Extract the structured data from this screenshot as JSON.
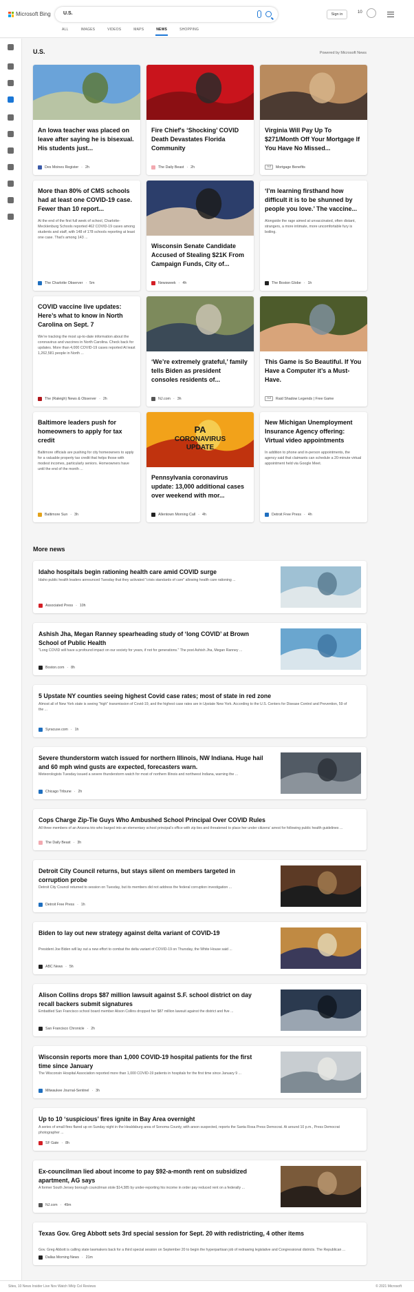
{
  "header": {
    "brand": "Microsoft Bing",
    "query": "U.S.",
    "sign_in": "Sign in",
    "rewards_count": "10"
  },
  "tabs": [
    {
      "label": "ALL",
      "active": false
    },
    {
      "label": "IMAGES",
      "active": false
    },
    {
      "label": "VIDEOS",
      "active": false
    },
    {
      "label": "MAPS",
      "active": false
    },
    {
      "label": "NEWS",
      "active": true
    },
    {
      "label": "SHOPPING",
      "active": false
    }
  ],
  "rail": [
    "expand-icon",
    "home-icon",
    "trending-icon",
    "flag-icon",
    "location-icon",
    "globe-icon",
    "finance-icon",
    "science-icon",
    "entertainment-icon",
    "business-icon",
    "car-icon"
  ],
  "section": {
    "title": "U.S.",
    "powered": "Powered by Microsoft News"
  },
  "cards": [
    {
      "headline": "An Iowa teacher was placed on leave after saying he is bisexual. His students just...",
      "summary": "",
      "source": "Des Moines Register",
      "time": "2h",
      "ad": false,
      "color": "#3b5aa8",
      "thumb": [
        "#6aa3d9",
        "#b8c4a4",
        "#5d7a3c"
      ]
    },
    {
      "headline": "Fire Chief's ‘Shocking’ COVID Death Devastates Florida Community",
      "summary": "",
      "source": "The Daily Beast",
      "time": "2h",
      "ad": false,
      "color": "#f2a9b0",
      "thumb": [
        "#c9141c",
        "#8b0f13",
        "#2a2a2a"
      ]
    },
    {
      "headline": "Virginia Will Pay Up To $271/Month Off Your Mortgage If You Have No Missed...",
      "summary": "",
      "source": "Mortgage Benefits",
      "time": "",
      "ad": true,
      "color": "#ffffff",
      "thumb": [
        "#b98b5e",
        "#4c3b32",
        "#d6b48a"
      ]
    },
    {
      "headline": "More than 80% of CMS schools had at least one COVID-19 case. Fewer than 10 report...",
      "summary": "At the end of the first full week of school, Charlotte-Mecklenburg Schools reported 462 COVID-19 cases among students and staff, with 148 of 178 schools reporting at least one case. That’s among 143 ...",
      "source": "The Charlotte Observer",
      "time": "5m",
      "ad": false,
      "color": "#1f6fbf",
      "thumb": null
    },
    {
      "headline": "Wisconsin Senate Candidate Accused of Stealing $21K From Campaign Funds, City of...",
      "summary": "",
      "source": "Newsweek",
      "time": "4h",
      "ad": false,
      "color": "#d41f26",
      "thumb": [
        "#2c3e6b",
        "#c9b7a4",
        "#1c1c1c"
      ]
    },
    {
      "headline": "‘I’m learning firsthand how difficult it is to be shunned by people you love.’ The vaccine...",
      "summary": "Alongside the rage aimed at unvaccinated, often distant, strangers, a more intimate, more uncomfortable fury is boiling.",
      "source": "The Boston Globe",
      "time": "1h",
      "ad": false,
      "color": "#222222",
      "thumb": null
    },
    {
      "headline": "COVID vaccine live updates: Here’s what to know in North Carolina on Sept. 7",
      "summary": "We’re tracking the most up-to-date information about the coronavirus and vaccines in North Carolina. Check back for updates. More than 4,000 COVID-19 cases reported At least 1,262,581 people in North ...",
      "source": "The (Raleigh) News & Observer",
      "time": "2h",
      "ad": false,
      "color": "#b0161b",
      "thumb": null
    },
    {
      "headline": "‘We’re extremely grateful,’ family tells Biden as president consoles residents of...",
      "summary": "",
      "source": "NJ.com",
      "time": "3h",
      "ad": false,
      "color": "#555555",
      "thumb": [
        "#7d8a5c",
        "#3b4a57",
        "#c8c2b0"
      ]
    },
    {
      "headline": "This Game is So Beautiful. If You Have a Computer it’s a Must-Have.",
      "summary": "",
      "source": "Raid Shadow Legends | Free Game",
      "time": "",
      "ad": true,
      "color": "#ffffff",
      "thumb": [
        "#4d5b2b",
        "#d8a47a",
        "#7e8f9b"
      ]
    },
    {
      "headline": "Baltimore leaders push for homeowners to apply for tax credit",
      "summary": "Baltimore officials are pushing for city homeowners to apply for a valuable property tax credit that helps those with modest incomes, particularly seniors. Homeowners have until the end of the month ...",
      "source": "Baltimore Sun",
      "time": "3h",
      "ad": false,
      "color": "#e3a21a",
      "thumb": null
    },
    {
      "headline": "Pennsylvania coronavirus update: 13,000 additional cases over weekend with mor...",
      "summary": "",
      "source": "Allentown Morning Call",
      "time": "4h",
      "ad": false,
      "color": "#222222",
      "thumb": [
        "#f2a21a",
        "#c0330e",
        "#f6d35a"
      ],
      "overlay": [
        "PA",
        "CORONAVIRUS",
        "UPDATE"
      ]
    },
    {
      "headline": "New Michigan Unemployment Insurance Agency offering: Virtual video appointments",
      "summary": "In addition to phone and in-person appointments, the agency said that claimants can schedule a 20-minute virtual appointment held via Google Meet.",
      "source": "Detroit Free Press",
      "time": "4h",
      "ad": false,
      "color": "#1f6fbf",
      "thumb": null
    }
  ],
  "more_news": {
    "title": "More news",
    "items": [
      {
        "headline": "Idaho hospitals begin rationing health care amid COVID surge",
        "summary": "Idaho public health leaders announced Tuesday that they activated \"crisis standards of care\" allowing health care rationing ...",
        "source": "Associated Press",
        "time": "10h",
        "color": "#d41f26",
        "thumb": [
          "#9fc1d4",
          "#dfe7ea",
          "#5a7d92"
        ]
      },
      {
        "headline": "Ashish Jha, Megan Ranney spearheading study of ‘long COVID’ at Brown School of Public Health",
        "summary": "\"Long COVID will have a profound impact on our society for years, if not for generations.\" The post Ashish Jha, Megan Ranney ...",
        "source": "Boston.com",
        "time": "8h",
        "color": "#222222",
        "thumb": [
          "#6aa6cf",
          "#d9e5ec",
          "#3f77a3"
        ]
      },
      {
        "headline": "5 Upstate NY counties seeing highest Covid case rates; most of state in red zone",
        "summary": "Almost all of New York state is seeing \"high\" transmission of Covid-19, and the highest case rates are in Upstate New York. According to the U.S. Centers for Disease Control and Prevention, 59 of the ...",
        "source": "Syracuse.com",
        "time": "1h",
        "color": "#1f6fbf",
        "thumb": null
      },
      {
        "headline": "Severe thunderstorm watch issued for northern Illinois, NW Indiana. Huge hail and 60 mph wind gusts are expected, forecasters warn.",
        "summary": "Meteorologists Tuesday issued a severe thunderstorm watch for most of northern Illinois and northwest Indiana, warning the ...",
        "source": "Chicago Tribune",
        "time": "2h",
        "color": "#1f6fbf",
        "thumb": [
          "#525b65",
          "#8b939b",
          "#2d333a"
        ]
      },
      {
        "headline": "Cops Charge Zip-Tie Guys Who Ambushed School Principal Over COVID Rules",
        "summary": "All three members of an Arizona trio who barged into an elementary school principal’s office with zip ties and threatened to place her under citizens’ arrest for following public health guidelines ...",
        "source": "The Daily Beast",
        "time": "3h",
        "color": "#f2a9b0",
        "thumb": null
      },
      {
        "headline": "Detroit City Council returns, but stays silent on members targeted in corruption probe",
        "summary": "Detroit City Council returned to session on Tuesday, but its members did not address the federal corruption investigation ...",
        "source": "Detroit Free Press",
        "time": "1h",
        "color": "#1f6fbf",
        "thumb": [
          "#5c3a25",
          "#1d1d1d",
          "#a07a4f"
        ]
      },
      {
        "headline": "Biden to lay out new strategy against delta variant of COVID-19",
        "summary": "President Joe Biden will lay out a new effort to combat the delta variant of COVID-19 on Thursday, the White House said ...",
        "source": "ABC News",
        "time": "5h",
        "color": "#222222",
        "thumb": [
          "#c08a43",
          "#3b3a5a",
          "#e2d4b0"
        ]
      },
      {
        "headline": "Alison Collins drops $87 million lawsuit against S.F. school district on day recall backers submit signatures",
        "summary": "Embattled San Francisco school board member Alison Collins dropped her $87 million lawsuit against the district and five ...",
        "source": "San Francisco Chronicle",
        "time": "2h",
        "color": "#222222",
        "thumb": [
          "#2b3a4f",
          "#9aa5b1",
          "#101820"
        ]
      },
      {
        "headline": "Wisconsin reports more than 1,000 COVID-19 hospital patients for the first time since January",
        "summary": "The Wisconsin Hospital Association reported more than 1,000 COVID-19 patients in hospitals for the first time since January 9 ...",
        "source": "Milwaukee Journal-Sentinel",
        "time": "3h",
        "color": "#1f6fbf",
        "thumb": [
          "#c8cdd1",
          "#7f8b94",
          "#e8e8e4"
        ]
      },
      {
        "headline": "Up to 10 ‘suspicious’ fires ignite in Bay Area overnight",
        "summary": "A series of small fires flared up on Sunday night in the Healdsburg area of Sonoma County, with arson suspected, reports the Santa Rosa Press Democrat. At around 10 p.m., Press Democrat photographer ...",
        "source": "SF Gate",
        "time": "8h",
        "color": "#d41f26",
        "thumb": null
      },
      {
        "headline": "Ex-councilman lied about income to pay $92-a-month rent on subsidized apartment, AG says",
        "summary": "A former South Jersey borough councilman stole $14,385 by under-reporting his income in order pay reduced rent on a federally ...",
        "source": "NJ.com",
        "time": "49m",
        "color": "#555555",
        "thumb": [
          "#7a5a3a",
          "#2a211b",
          "#b89670"
        ]
      },
      {
        "headline": "Texas Gov. Greg Abbott sets 3rd special session for Sept. 20 with redistricting, 4 other items",
        "summary": "Gov. Greg Abbott is calling state lawmakers back for a third special session on September 20 to begin the hyperpartisan job of redrawing legislative and Congressional districts. The Republican ...",
        "source": "Dallas Morning News",
        "time": "21m",
        "color": "#222222",
        "thumb": null
      }
    ]
  },
  "footer": {
    "left": "Sites, 10 News Insider Live Nov Watch Wkly Col Reviews",
    "right": "© 2021 Microsoft"
  }
}
